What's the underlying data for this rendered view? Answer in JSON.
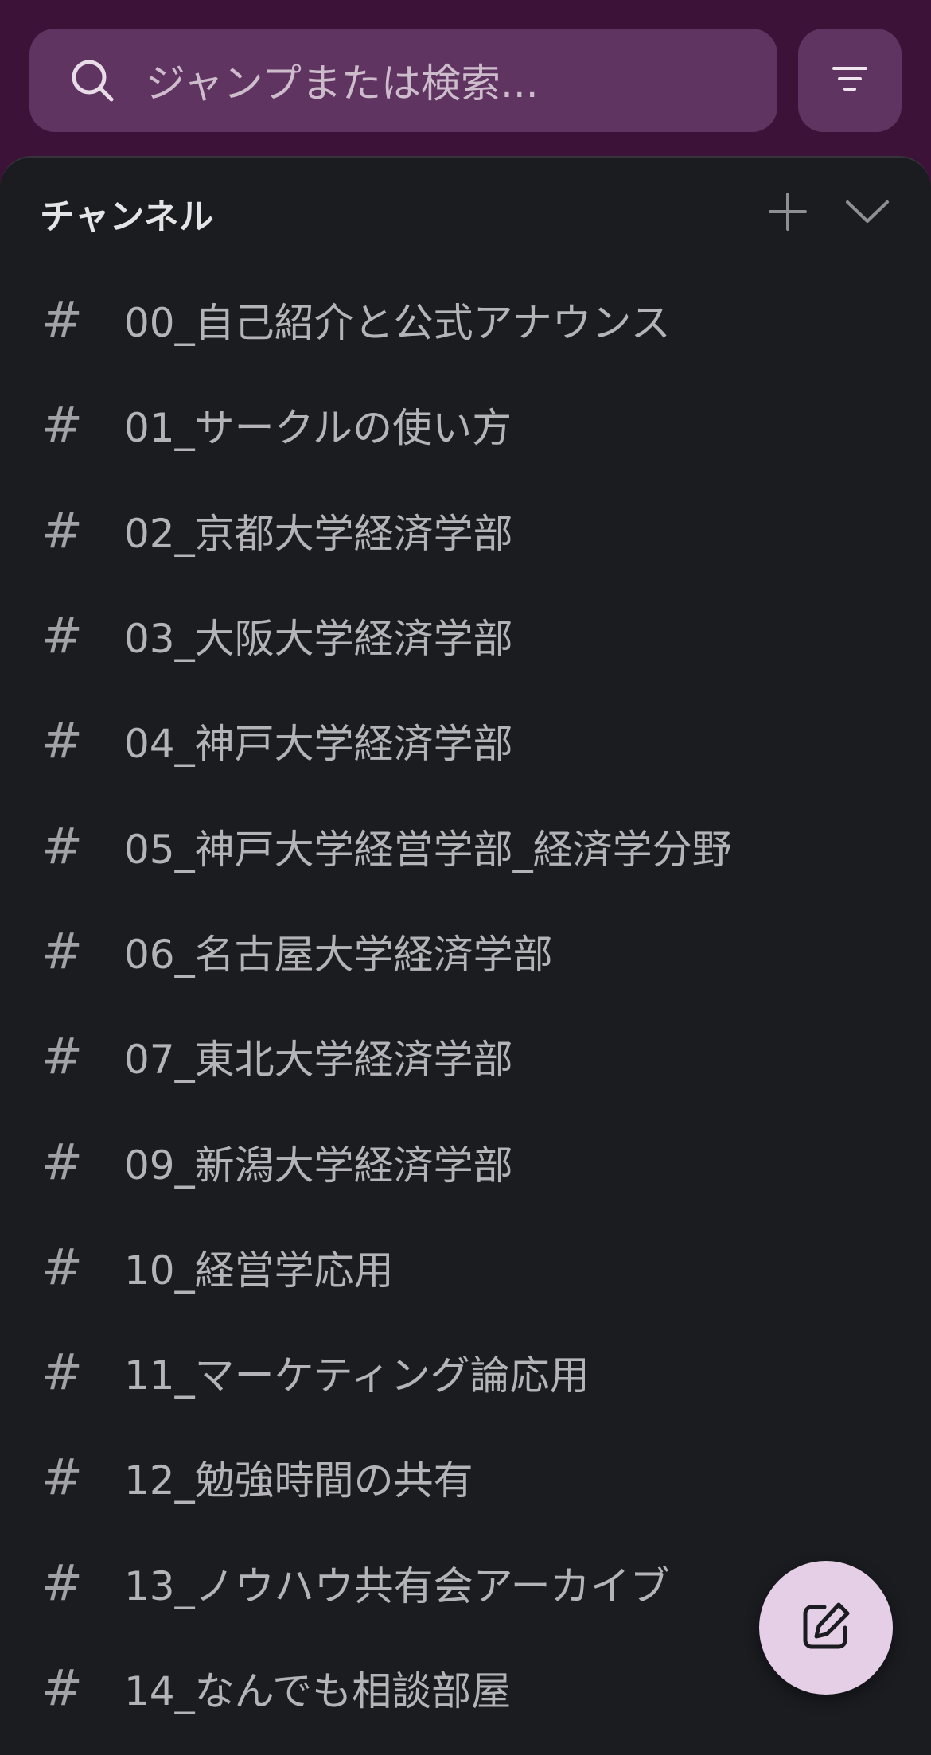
{
  "search": {
    "placeholder": "ジャンプまたは検索..."
  },
  "section": {
    "title": "チャンネル"
  },
  "channels": [
    {
      "prefix": "#",
      "name": "00_自己紹介と公式アナウンス"
    },
    {
      "prefix": "#",
      "name": "01_サークルの使い方"
    },
    {
      "prefix": "#",
      "name": "02_京都大学経済学部"
    },
    {
      "prefix": "#",
      "name": "03_大阪大学経済学部"
    },
    {
      "prefix": "#",
      "name": "04_神戸大学経済学部"
    },
    {
      "prefix": "#",
      "name": "05_神戸大学経営学部_経済学分野"
    },
    {
      "prefix": "#",
      "name": "06_名古屋大学経済学部"
    },
    {
      "prefix": "#",
      "name": "07_東北大学経済学部"
    },
    {
      "prefix": "#",
      "name": "09_新潟大学経済学部"
    },
    {
      "prefix": "#",
      "name": "10_経営学応用"
    },
    {
      "prefix": "#",
      "name": "11_マーケティング論応用"
    },
    {
      "prefix": "#",
      "name": "12_勉強時間の共有"
    },
    {
      "prefix": "#",
      "name": "13_ノウハウ共有会アーカイブ"
    },
    {
      "prefix": "#",
      "name": "14_なんでも相談部屋"
    }
  ],
  "icons": {
    "search": "search-icon",
    "filter": "filter-icon",
    "add": "plus-icon",
    "collapse": "chevron-down-icon",
    "channel": "hash-icon",
    "compose": "compose-icon"
  },
  "colors": {
    "header_bg": "#3d1239",
    "search_bg": "#5f3460",
    "sheet_bg": "#1b1c20",
    "fab_bg": "#e5cfe7"
  }
}
